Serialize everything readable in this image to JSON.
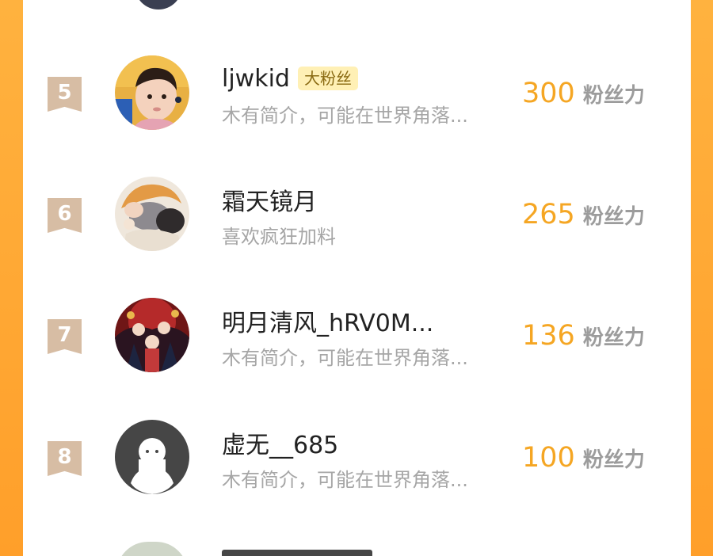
{
  "ranking": {
    "rows": [
      {
        "rank": "5",
        "name": "ljwkid",
        "tag": "大粉丝",
        "desc": "木有简介，可能在世界角落...",
        "score": "300",
        "unit": "粉丝力",
        "avatar": "child-photo-avatar"
      },
      {
        "rank": "6",
        "name": "霜天镜月",
        "tag": "",
        "desc": "喜欢疯狂加料",
        "score": "265",
        "unit": "粉丝力",
        "avatar": "anime-illustration-avatar"
      },
      {
        "rank": "7",
        "name": "明月清风_hRV0M...",
        "tag": "",
        "desc": "木有简介，可能在世界角落...",
        "score": "136",
        "unit": "粉丝力",
        "avatar": "anime-group-avatar"
      },
      {
        "rank": "8",
        "name": "虚无__685",
        "tag": "",
        "desc": "木有简介，可能在世界角落...",
        "score": "100",
        "unit": "粉丝力",
        "avatar": "default-ghost-avatar"
      }
    ]
  },
  "colors": {
    "background": "#ffa935",
    "rank_badge": "#d7bda4",
    "score": "#f5a623",
    "tag_bg": "#fff0b5"
  }
}
